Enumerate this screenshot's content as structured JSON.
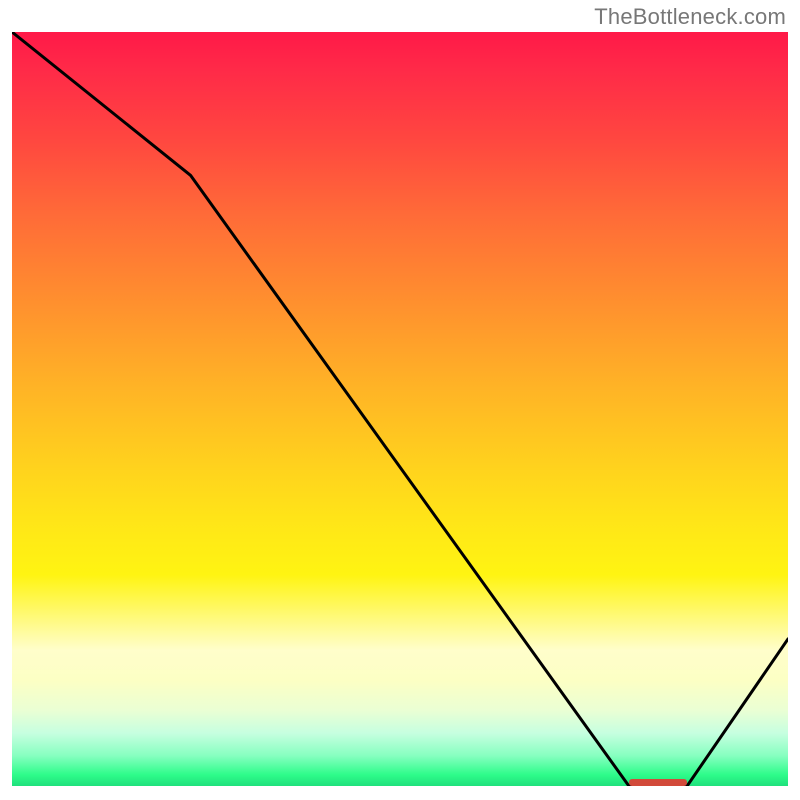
{
  "attribution": "TheBottleneck.com",
  "colors": {
    "line": "#000000",
    "marker": "#d24a3a"
  },
  "chart_data": {
    "type": "line",
    "title": "",
    "xlabel": "",
    "ylabel": "",
    "xlim": [
      0,
      100
    ],
    "ylim": [
      0,
      100
    ],
    "grid": false,
    "legend": false,
    "x": [
      0,
      23,
      79.5,
      87,
      100
    ],
    "values": [
      100,
      81,
      0,
      0,
      19.5
    ],
    "background_gradient_note": "vertical red→yellow→green heatmap behind the line",
    "marker": {
      "x_start": 79.5,
      "x_end": 87,
      "y": 0
    }
  }
}
